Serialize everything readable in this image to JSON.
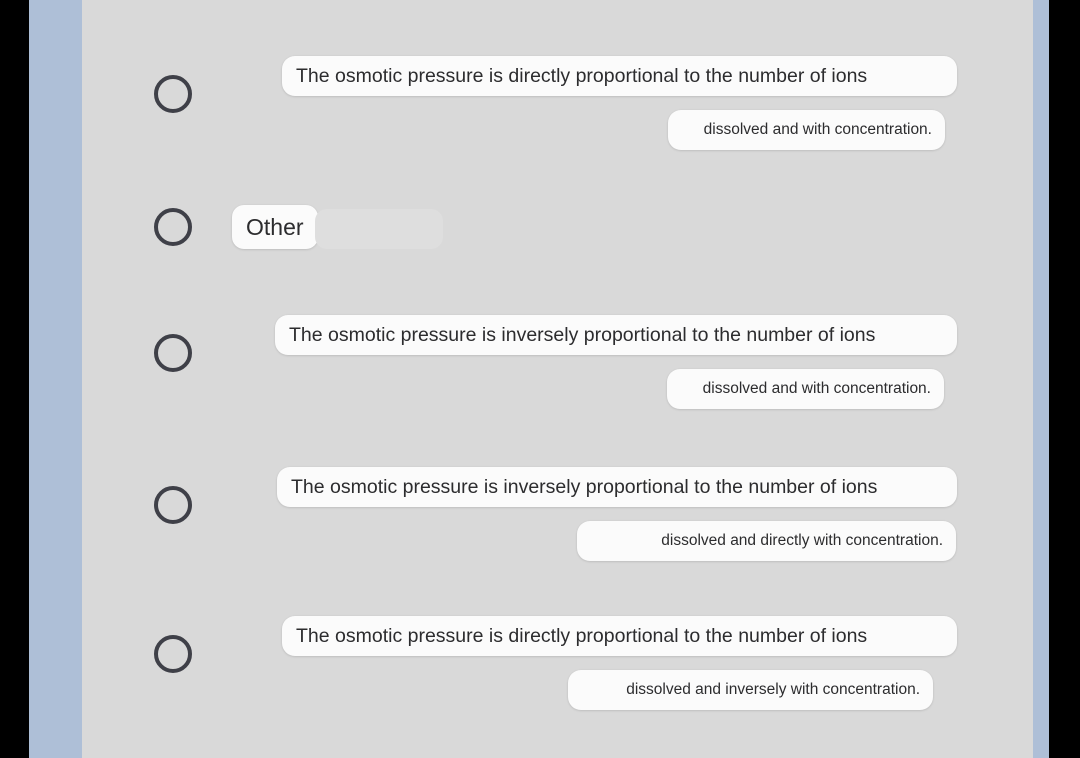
{
  "colors": {
    "page_backdrop": "#000000",
    "page_rail": "#aebfd7",
    "form_surface": "#d9d9d9",
    "bubble": "#fbfbfb",
    "radio_stroke": "#3f4048",
    "text": "#2c2c2e",
    "other_input": "#dedede"
  },
  "form": {
    "options": [
      {
        "id": "option-1",
        "selected": false,
        "line_primary": "The osmotic pressure is directly proportional to the number of ions",
        "line_secondary": "dissolved and with concentration."
      },
      {
        "id": "option-other",
        "selected": false,
        "label": "Other",
        "input_value": "",
        "input_placeholder": ""
      },
      {
        "id": "option-2",
        "selected": false,
        "line_primary": "The osmotic pressure is inversely proportional to the number of ions",
        "line_secondary": "dissolved and with concentration."
      },
      {
        "id": "option-3",
        "selected": false,
        "line_primary": "The osmotic pressure is inversely proportional to the number of ions",
        "line_secondary": "dissolved and directly with concentration."
      },
      {
        "id": "option-4",
        "selected": false,
        "line_primary": "The osmotic pressure is directly proportional to the number of ions",
        "line_secondary": "dissolved and inversely with concentration."
      }
    ]
  }
}
